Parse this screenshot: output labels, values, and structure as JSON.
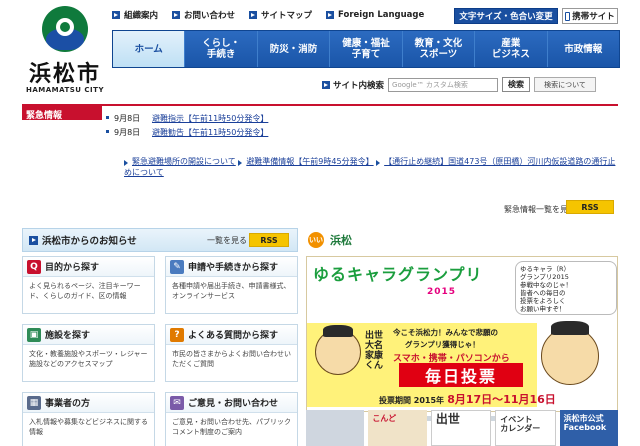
{
  "logo": {
    "name_ja": "浜松市",
    "name_en": "HAMAMATSU CITY"
  },
  "utility_links": [
    {
      "label": "組織案内"
    },
    {
      "label": "お問い合わせ"
    },
    {
      "label": "サイトマップ"
    },
    {
      "label": "Foreign Language"
    }
  ],
  "header_buttons": {
    "text_size": "文字サイズ・色合い変更",
    "mobile": "携帯サイト"
  },
  "global_nav": [
    {
      "label": "ホーム"
    },
    {
      "label": "くらし・\n手続き"
    },
    {
      "label": "防災・消防"
    },
    {
      "label": "健康・福祉\n子育て"
    },
    {
      "label": "教育・文化\nスポーツ"
    },
    {
      "label": "産業\nビジネス"
    },
    {
      "label": "市政情報"
    }
  ],
  "search": {
    "label": "サイト内検索",
    "placeholder": "Google™ カスタム検索",
    "button": "検索",
    "help": "検索について"
  },
  "emergency": {
    "title": "緊急情報",
    "alerts": [
      {
        "date": "9月8日",
        "text": "避難指示【午前11時50分発令】"
      },
      {
        "date": "9月8日",
        "text": "避難勧告【午前11時50分発令】"
      }
    ],
    "list": [
      "緊急避難場所の開設について",
      "避難準備情報【午前9時45分発令】",
      "【通行止め継続】国道473号（原田橋）河川内仮設道路の通行止めについて"
    ],
    "more": "緊急情報一覧を見る",
    "rss": "RSS"
  },
  "news": {
    "title": "浜松市からのお知らせ",
    "all": "一覧を見る",
    "rss": "RSS"
  },
  "cards": [
    {
      "icon": "Q",
      "icon_color": "#c8102e",
      "title": "目的から探す",
      "desc": "よく見られるページ、注目キーワード、くらしのガイド、区の情報"
    },
    {
      "icon": "✎",
      "icon_color": "#4a7bbf",
      "title": "申請や手続きから探す",
      "desc": "各種申請や届出手続き、申請書様式、オンラインサービス"
    },
    {
      "icon": "▣",
      "icon_color": "#2e8b57",
      "title": "施設を探す",
      "desc": "文化・教養施設やスポーツ・レジャー施設などのアクセスマップ"
    },
    {
      "icon": "?",
      "icon_color": "#e07a00",
      "title": "よくある質問から探す",
      "desc": "市民の皆さまからよくお問い合わせいただくご質問"
    },
    {
      "icon": "▦",
      "icon_color": "#5a6b8c",
      "title": "事業者の方",
      "desc": "入札情報や募集などビジネスに関する情報"
    },
    {
      "icon": "✉",
      "icon_color": "#7a5aa8",
      "title": "ご意見・お問い合わせ",
      "desc": "ご意見・お問い合わせ先、パブリックコメント制度のご案内"
    }
  ],
  "banner": {
    "logo_dot": "いい",
    "logo_text": "浜松",
    "gp_title": "ゆるキャラグランプリ",
    "gp_year": "2015",
    "callout_1": "ゆるキャラ（R）",
    "callout_2": "グランプリ2015",
    "callout_3": "参戦中なのじゃ！",
    "callout_4": "皆者への毎日の",
    "callout_5": "投票をよろしく",
    "callout_6": "お願い申すぞ！",
    "side_name": "出世大名家康くん",
    "msg1": "今こそ浜松力！みんなで悲願の",
    "msg2": "グランプリ獲得じゃ！",
    "msg3": "スマホ・携帯・パソコンから",
    "cta": "毎日投票",
    "period_prefix": "投票期間 2015年",
    "period_start": "8月17日",
    "period_mid": "〜",
    "period_end": "11月16日",
    "period_suffix": "月"
  },
  "thumbs": [
    {
      "text": ""
    },
    {
      "text": "こんど"
    },
    {
      "text": "出世"
    },
    {
      "text": "イベント\nカレンダー"
    },
    {
      "text": "浜松市公式\nFacebook"
    }
  ]
}
